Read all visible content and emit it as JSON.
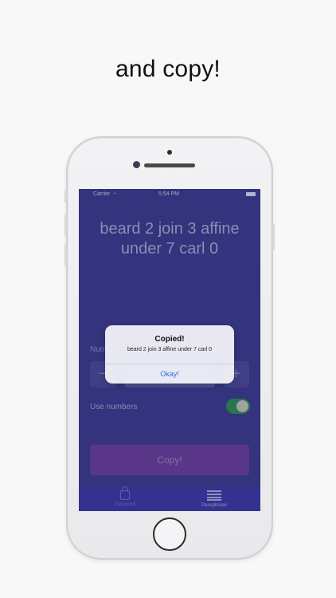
{
  "headline": "and copy!",
  "status_bar": {
    "carrier": "Carrier",
    "time": "5:54 PM"
  },
  "phrase": "beard 2 join 3 affine under 7 carl 0",
  "controls": {
    "number_label": "Num",
    "minus": "−",
    "plus": "+",
    "use_numbers_label": "Use numbers",
    "use_numbers_enabled": true,
    "copy_button": "Copy!"
  },
  "tabs": [
    {
      "label": "Password",
      "icon": "lock-icon",
      "active": false
    },
    {
      "label": "Passphrase",
      "icon": "list-icon",
      "active": true
    }
  ],
  "alert": {
    "title": "Copied!",
    "message": "beard 2 join 3 affine under 7 carl 0",
    "button": "Okay!"
  },
  "colors": {
    "screen_bg": "#3b3a8c",
    "toggle_on": "#2f8a54",
    "copy_button": "#6a3d9a",
    "alert_button_text": "#2a74d8"
  }
}
